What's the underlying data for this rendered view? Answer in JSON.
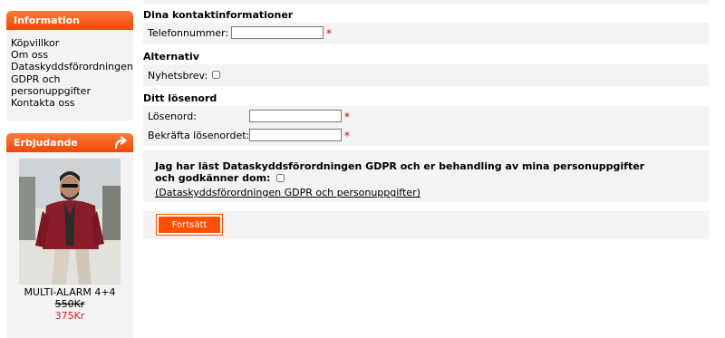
{
  "sidebar": {
    "info_box": {
      "title": "Information",
      "links": [
        "Köpvillkor",
        "Om oss",
        "Dataskyddsförordningen",
        "GDPR och",
        "personuppgifter",
        "Kontakta oss"
      ]
    },
    "special_box": {
      "title": "Erbjudande",
      "icon": "redo-icon",
      "product": {
        "name": "MULTI-ALARM 4+4",
        "old_price": "550Kr",
        "new_price": "375Kr"
      }
    }
  },
  "form": {
    "contact": {
      "title": "Dina kontaktinformationer",
      "phone_label": "Telefonnummer:",
      "phone_value": "",
      "required_mark": "*"
    },
    "options": {
      "title": "Alternativ",
      "newsletter_label": "Nyhetsbrev:",
      "newsletter_checked": false
    },
    "password": {
      "title": "Ditt lösenord",
      "password_label": "Lösenord:",
      "password_value": "",
      "confirm_label": "Bekräfta lösenordet:",
      "confirm_value": "",
      "required_mark": "*"
    },
    "gdpr": {
      "text": "Jag har läst Dataskyddsförordningen GDPR och er behandling av mina personuppgifter och godkänner dom:",
      "checked": false,
      "link_text": "(Dataskyddsförordningen GDPR och personuppgifter)"
    },
    "continue_label": "Fortsätt"
  },
  "colors": {
    "accent": "#ff4f06",
    "panel_bg": "#f4f2f2",
    "required": "#e00000",
    "new_price": "#e8161a"
  }
}
